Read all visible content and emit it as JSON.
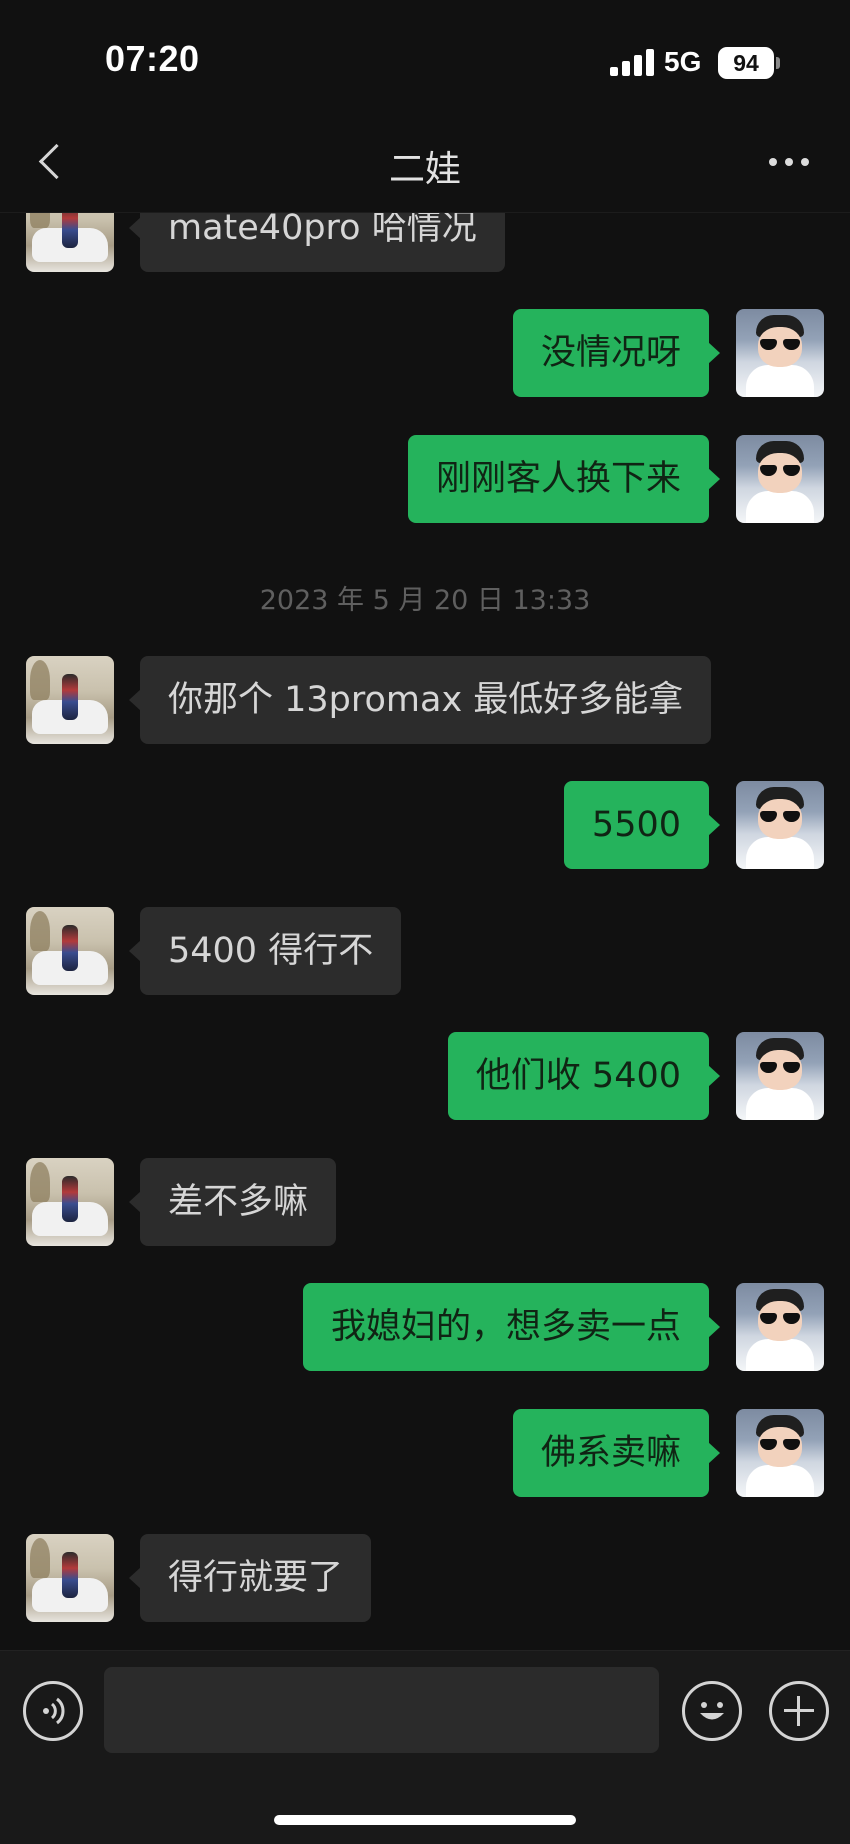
{
  "status_bar": {
    "time": "07:20",
    "network": "5G",
    "battery": "94"
  },
  "header": {
    "title": "二娃",
    "back_icon": "chevron-left-icon",
    "more_icon": "ellipsis-icon"
  },
  "messages": [
    {
      "sender": "other",
      "text": "mate40pro 哈情况"
    },
    {
      "sender": "self",
      "text": "没情况呀"
    },
    {
      "sender": "self",
      "text": "刚刚客人换下来"
    },
    {
      "type": "timestamp",
      "text": "2023 年 5 月 20 日 13:33"
    },
    {
      "sender": "other",
      "text": "你那个 13promax 最低好多能拿"
    },
    {
      "sender": "self",
      "text": "5500"
    },
    {
      "sender": "other",
      "text": "5400 得行不"
    },
    {
      "sender": "self",
      "text": "他们收 5400"
    },
    {
      "sender": "other",
      "text": "差不多嘛"
    },
    {
      "sender": "self",
      "text": "我媳妇的，想多卖一点"
    },
    {
      "sender": "self",
      "text": "佛系卖嘛"
    },
    {
      "sender": "other",
      "text": "得行就要了"
    }
  ],
  "input_bar": {
    "placeholder": "",
    "voice_icon": "voice-icon",
    "emoji_icon": "emoji-icon",
    "plus_icon": "plus-icon"
  },
  "colors": {
    "background": "#111111",
    "self_bubble": "#25b35c",
    "other_bubble": "#2c2c2c",
    "timestamp_text": "#5f5f5f"
  }
}
